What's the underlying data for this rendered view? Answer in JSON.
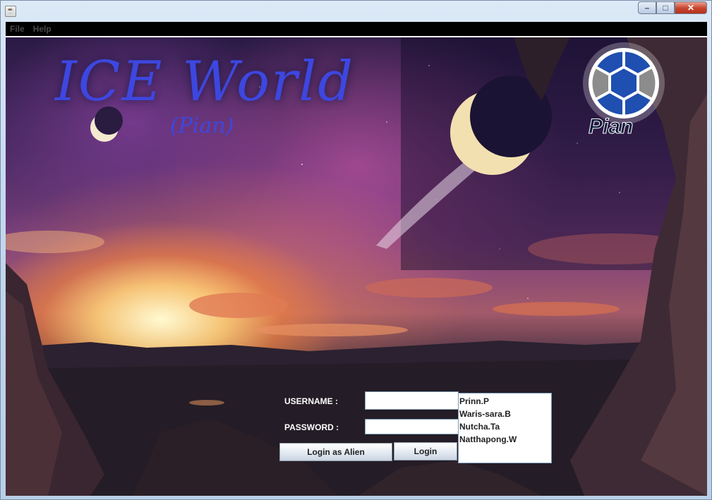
{
  "window": {
    "app_icon": "java-icon",
    "controls": {
      "minimize": "–",
      "maximize": "□",
      "close": "✕"
    }
  },
  "menu": {
    "items": [
      "File",
      "Help"
    ]
  },
  "header": {
    "title": "ICE World",
    "subtitle": "(Pian)"
  },
  "logo": {
    "text": "Pian",
    "colors": {
      "blue": "#1f4fb0",
      "gray": "#8c8c8c"
    }
  },
  "login": {
    "username_label": "USERNAME :",
    "username_value": "",
    "password_label": "PASSWORD :",
    "password_value": "",
    "alien_button": "Login as Alien",
    "login_button": "Login"
  },
  "user_list": [
    "Prinn.P",
    "Waris-sara.B",
    "Nutcha.Ta",
    "Natthapong.W"
  ],
  "colors": {
    "title": "#3d47e0",
    "menubar": "#000000"
  }
}
